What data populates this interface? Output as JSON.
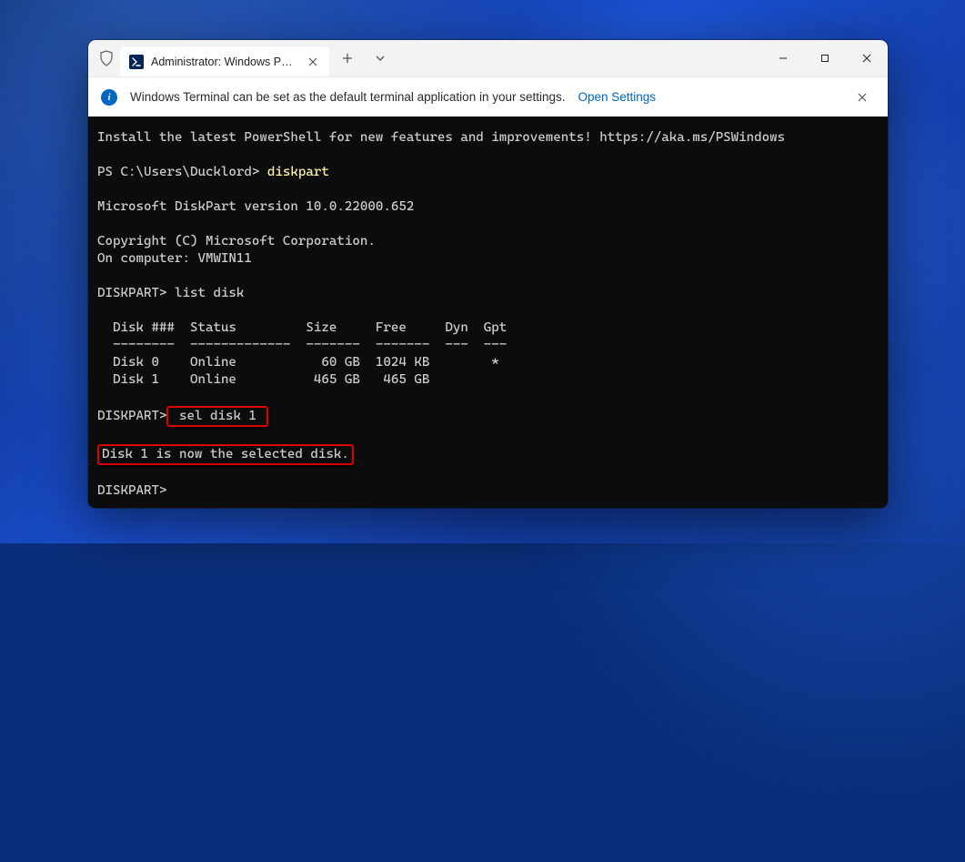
{
  "tab": {
    "title": "Administrator: Windows Powe"
  },
  "infobar": {
    "message": "Windows Terminal can be set as the default terminal application in your settings.",
    "link": "Open Settings"
  },
  "terminal": {
    "install_msg": "Install the latest PowerShell for new features and improvements! https://aka.ms/PSWindows",
    "prompt1_path": "PS C:\\Users\\Ducklord> ",
    "prompt1_cmd": "diskpart",
    "version_line": "Microsoft DiskPart version 10.0.22000.652",
    "copyright_line": "Copyright (C) Microsoft Corporation.",
    "computer_line": "On computer: VMWIN11",
    "dp_prompt1": "DISKPART> list disk",
    "table": {
      "header": "  Disk ###  Status         Size     Free     Dyn  Gpt",
      "divider": "  --------  -------------  -------  -------  ---  ---",
      "row0": "  Disk 0    Online           60 GB  1024 KB        *",
      "row1": "  Disk 1    Online          465 GB   465 GB"
    },
    "dp_prompt2_prefix": "DISKPART>",
    "dp_prompt2_cmd": " sel disk 1 ",
    "selected_msg": "Disk 1 is now the selected disk.",
    "dp_prompt3": "DISKPART>"
  }
}
